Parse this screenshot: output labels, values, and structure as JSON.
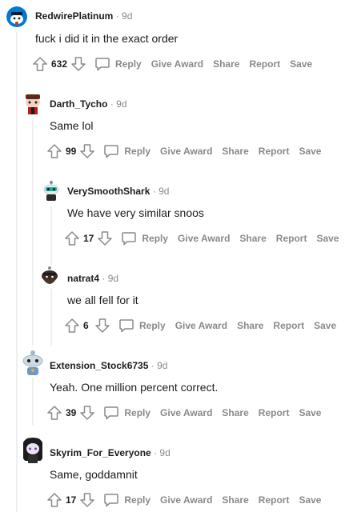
{
  "actions": {
    "reply": "Reply",
    "give_award": "Give Award",
    "share": "Share",
    "report": "Report",
    "save": "Save"
  },
  "separator": "·",
  "comments": [
    {
      "author": "RedwirePlatinum",
      "time": "9d",
      "body": "fuck i did it in the exact order",
      "score": "632",
      "avatar_bg": "#0079d3"
    },
    {
      "author": "Darth_Tycho",
      "time": "9d",
      "body": "Same lol",
      "score": "99",
      "avatar_bg": "#ffffff"
    },
    {
      "author": "VerySmoothShark",
      "time": "9d",
      "body": "We have very similar snoos",
      "score": "17",
      "avatar_bg": "#ffffff"
    },
    {
      "author": "natrat4",
      "time": "9d",
      "body": "we all fell for it",
      "score": "6",
      "avatar_bg": "#ffffff"
    },
    {
      "author": "Extension_Stock6735",
      "time": "9d",
      "body": "Yeah. One million percent correct.",
      "score": "39",
      "avatar_bg": "#ffffff"
    },
    {
      "author": "Skyrim_For_Everyone",
      "time": "9d",
      "body": "Same, goddamnit",
      "score": "17",
      "avatar_bg": "#ffffff"
    }
  ]
}
